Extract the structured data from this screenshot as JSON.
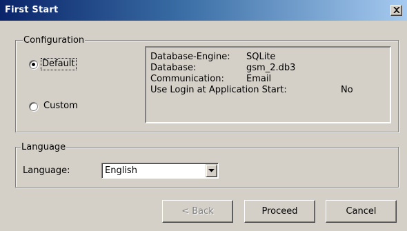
{
  "window": {
    "title": "First Start",
    "close_glyph": "close-icon"
  },
  "configuration": {
    "legend": "Configuration",
    "options": [
      {
        "label": "Default",
        "selected": true
      },
      {
        "label": "Custom",
        "selected": false
      }
    ],
    "info": [
      {
        "key": "Database-Engine:",
        "value": "SQLite"
      },
      {
        "key": "Database:",
        "value": "gsm_2.db3"
      },
      {
        "key": "Communication:",
        "value": "Email"
      },
      {
        "key": "Use Login at  Application Start:",
        "value": "No"
      }
    ]
  },
  "language": {
    "legend": "Language",
    "label": "Language:",
    "selected": "English"
  },
  "buttons": {
    "back": "< Back",
    "proceed": "Proceed",
    "cancel": "Cancel"
  },
  "colors": {
    "dialog_face": "#d4d0c8",
    "titlebar_start": "#0a246a",
    "titlebar_end": "#a6caf0",
    "disabled_text": "#808080"
  }
}
